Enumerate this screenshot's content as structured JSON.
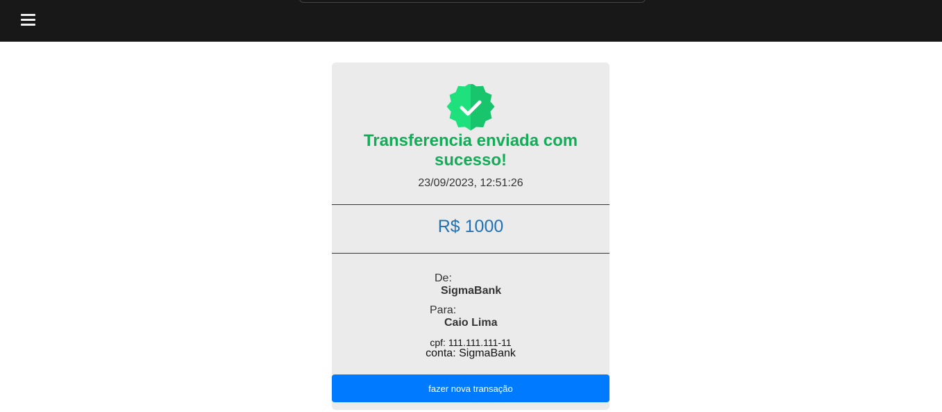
{
  "header": {
    "menu_icon": "hamburger-menu-icon"
  },
  "receipt": {
    "status_icon": "verified-check-badge-icon",
    "title_line1": "Transferencia enviada com",
    "title_line2": "sucesso!",
    "datetime": "23/09/2023, 12:51:26",
    "amount": "R$ 1000",
    "from_label": "De:",
    "from_value": "SigmaBank",
    "to_label": "Para:",
    "to_value": "Caio Lima",
    "cpf": "cpf: 111.111.111-11",
    "conta": "conta: SigmaBank",
    "new_transaction_label": "fazer nova transação"
  },
  "colors": {
    "header_bg": "#181818",
    "success_green": "#14ac58",
    "amount_blue": "#2171b5",
    "button_blue": "#007bff",
    "card_bg": "#ebebeb"
  }
}
